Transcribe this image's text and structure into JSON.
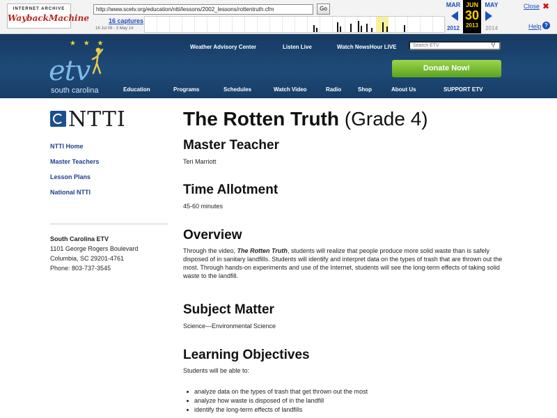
{
  "wayback": {
    "logo_top": "INTERNET ARCHIVE",
    "logo_main": "WaybackMachine",
    "url": "http://www.scetv.org/education/ntti/lessons/2002_lessons/rottentruth.cfm",
    "go_label": "Go",
    "captures": "16 captures",
    "range": "16 Jul 08 - 3 May 14",
    "prev_month": "MAR",
    "prev_year": "2012",
    "cur_month": "JUN",
    "cur_day": "30",
    "cur_year": "2013",
    "next_month": "MAY",
    "next_year": "2014",
    "close": "Close",
    "help": "Help",
    "close_icon": "close-x-icon",
    "help_icon": "question-icon"
  },
  "etv": {
    "logo": "etv",
    "tagline": "south carolina",
    "top_links": [
      "Weather Advisory Center",
      "Listen Live",
      "Watch NewsHour LIVE"
    ],
    "search_placeholder": "Search ETV",
    "donate": "Donate Now!",
    "nav": [
      "Education",
      "Programs",
      "Schedules",
      "Watch Video",
      "Radio",
      "Shop",
      "About Us",
      "SUPPORT ETV"
    ],
    "colors": {
      "header": "#1f4a78",
      "donate": "#6fb52c"
    }
  },
  "sidebar": {
    "logo_text": "NTTI",
    "links": [
      "NTTI Home",
      "Master Teachers",
      "Lesson Plans",
      "National NTTI"
    ],
    "address": [
      "South Carolina ETV",
      "1101 George Rogers Boulevard",
      "Columbia, SC 29201-4761",
      "Phone: 803-737-3545"
    ]
  },
  "main": {
    "title": "The Rotten Truth",
    "grade": "(Grade 4)",
    "master_teacher_h": "Master Teacher",
    "master_teacher": "Teri Marriott",
    "time_h": "Time Allotment",
    "time": "45-60 minutes",
    "overview_h": "Overview",
    "overview_pre": "Through the video, ",
    "overview_em": "The Rotten Truth",
    "overview_post": ", students will realize that people produce more solid waste than is safely disposed of in sanitary landfills. Students will identify and interpret data on the types of trash that are thrown out the most. Through hands-on experiments and use of the Internet, students will see the long-term effects of taking solid waste to the landfill.",
    "subject_h": "Subject Matter",
    "subject": "Science—Environmental Science",
    "objectives_h": "Learning Objectives",
    "objectives_intro": "Students will be able to:",
    "objectives": [
      "analyze data on the types of trash that get thrown out the most",
      "analyze how waste is disposed of in the landfill",
      "identify the long-term effects of landfills"
    ]
  }
}
